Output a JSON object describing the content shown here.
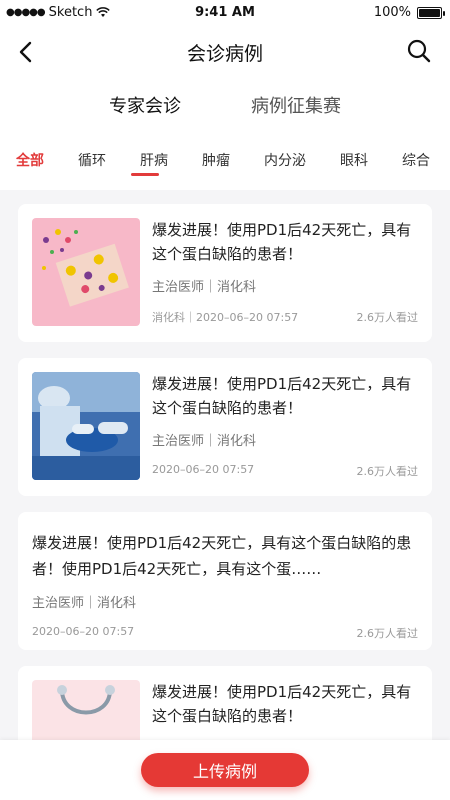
{
  "status_bar": {
    "carrier": "Sketch",
    "time": "9:41 AM",
    "battery": "100%"
  },
  "nav": {
    "title": "会诊病例"
  },
  "main_tabs": [
    {
      "label": "专家会诊",
      "active": true
    },
    {
      "label": "病例征集赛",
      "active": false
    }
  ],
  "categories": [
    {
      "label": "全部",
      "active": true
    },
    {
      "label": "循环"
    },
    {
      "label": "肝病"
    },
    {
      "label": "肿瘤"
    },
    {
      "label": "内分泌"
    },
    {
      "label": "眼科"
    },
    {
      "label": "综合"
    }
  ],
  "cards": [
    {
      "title": "爆发进展！使用PD1后42天死亡，具有这个蛋白缺陷的患者！",
      "author": "主治医师｜消化科",
      "department": "消化科",
      "date": "2020–06–20 07:57",
      "views": "2.6万人看过"
    },
    {
      "title": "爆发进展！使用PD1后42天死亡，具有这个蛋白缺陷的患者！",
      "author": "主治医师｜消化科",
      "date": "2020–06–20 07:57",
      "views": "2.6万人看过"
    },
    {
      "title": "爆发进展！使用PD1后42天死亡，具有这个蛋白缺陷的患者！使用PD1后42天死亡，具有这个蛋……",
      "author": "主治医师｜消化科",
      "date": "2020–06–20 07:57",
      "views": "2.6万人看过"
    },
    {
      "title": "爆发进展！使用PD1后42天死亡，具有这个蛋白缺陷的患者！"
    }
  ],
  "bottom": {
    "upload_label": "上传病例"
  },
  "colors": {
    "accent": "#e53935"
  }
}
